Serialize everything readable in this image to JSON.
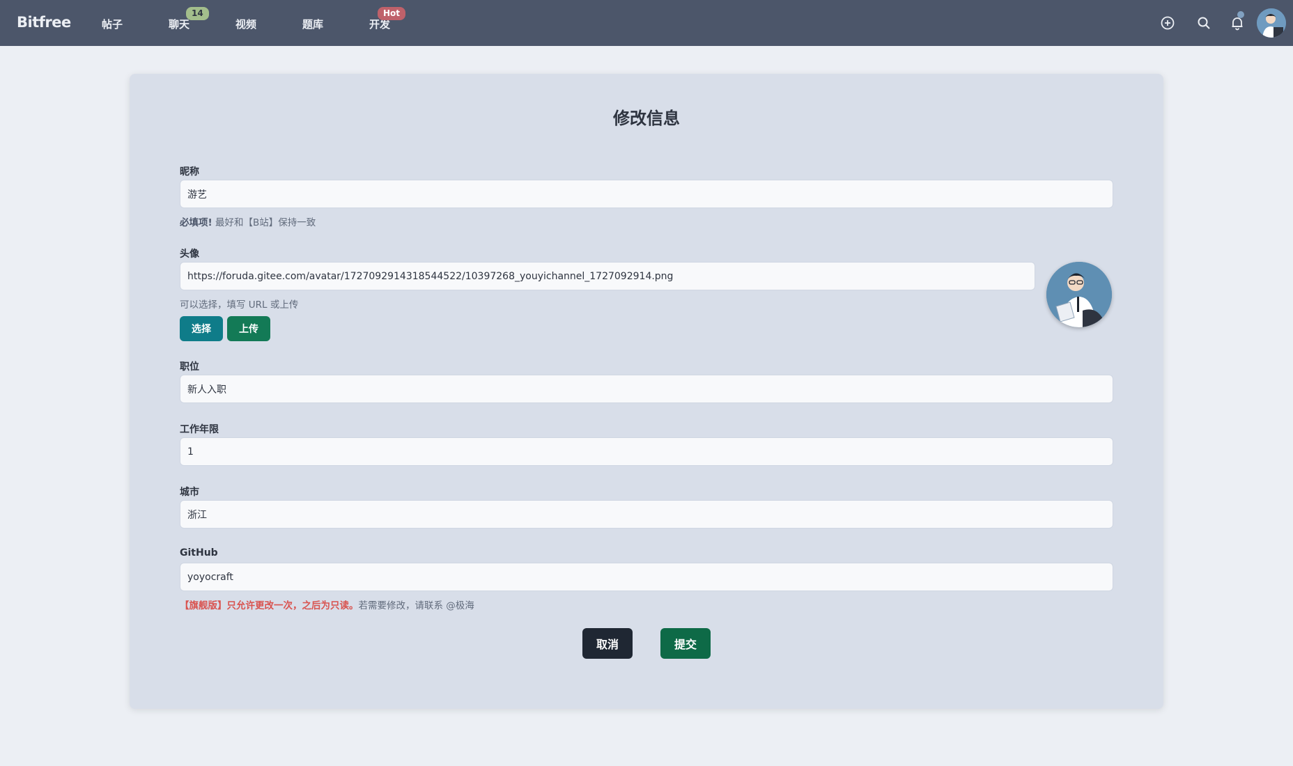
{
  "nav": {
    "brand": "Bitfree",
    "items": [
      {
        "label": "帖子"
      },
      {
        "label": "聊天",
        "badge": "14"
      },
      {
        "label": "视频"
      },
      {
        "label": "题库"
      },
      {
        "label": "开发",
        "badge": "Hot"
      }
    ],
    "icons": [
      "plus-circle-icon",
      "search-icon",
      "bell-icon",
      "user-avatar"
    ]
  },
  "form": {
    "title": "修改信息",
    "nickname": {
      "label": "昵称",
      "value": "游艺",
      "hint_strong": "必填项!",
      "hint": " 最好和【B站】保持一致"
    },
    "avatar": {
      "label": "头像",
      "value": "https://foruda.gitee.com/avatar/1727092914318544522/10397268_youyichannel_1727092914.png",
      "hint": "可以选择，填写 URL 或上传",
      "select_label": "选择",
      "upload_label": "上传"
    },
    "position": {
      "label": "职位",
      "value": "新人入职"
    },
    "years": {
      "label": "工作年限",
      "value": "1"
    },
    "city": {
      "label": "城市",
      "value": "浙江"
    },
    "github": {
      "label": "GitHub",
      "value": "yoyocraft",
      "warn": "【旗舰版】只允许更改一次，之后为只读。",
      "hint": "若需要修改，请联系 @极海"
    },
    "cancel_label": "取消",
    "submit_label": "提交"
  },
  "colors": {
    "navbar": "#4c566a",
    "page_bg": "#eceff4",
    "card_bg": "#d8dee9",
    "select_btn": "#0f7c89",
    "upload_btn": "#137a56",
    "cancel_btn": "#1f2733",
    "submit_btn": "#0e6a47",
    "warning": "#d9534f"
  }
}
